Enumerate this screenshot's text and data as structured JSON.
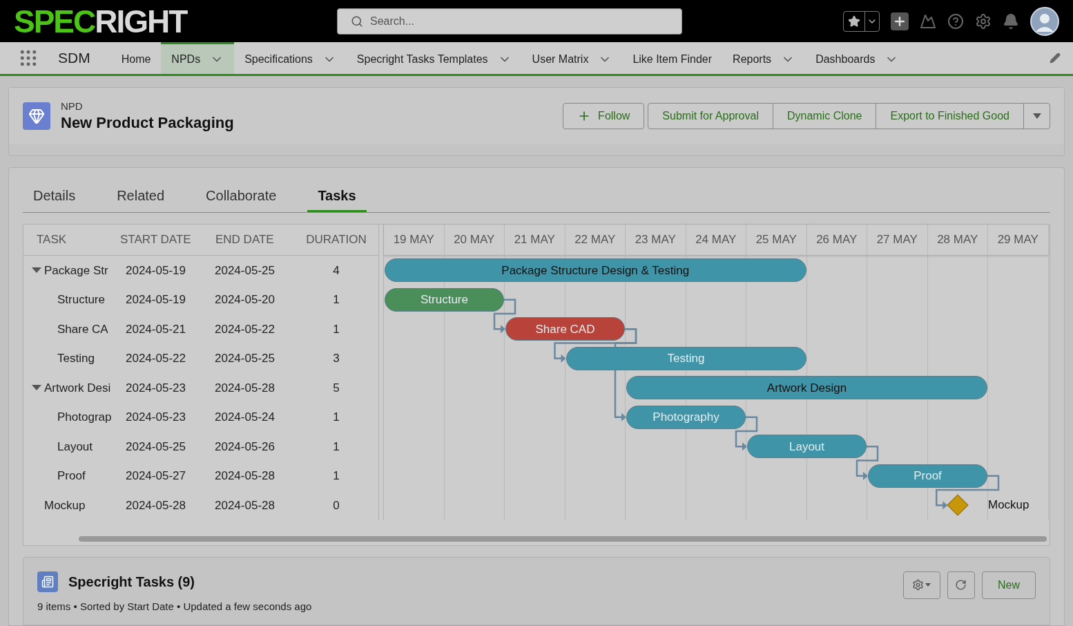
{
  "header": {
    "logo": {
      "part_1": "SPEC",
      "part_2": "RIGHT"
    },
    "search": {
      "placeholder": "Search..."
    }
  },
  "nav": {
    "app_name": "SDM",
    "items": [
      {
        "label": "Home",
        "has_menu": false,
        "selected": false
      },
      {
        "label": "NPDs",
        "has_menu": true,
        "selected": true
      },
      {
        "label": "Specifications",
        "has_menu": true,
        "selected": false
      },
      {
        "label": "Specright Tasks Templates",
        "has_menu": true,
        "selected": false
      },
      {
        "label": "User Matrix",
        "has_menu": true,
        "selected": false
      },
      {
        "label": "Like Item Finder",
        "has_menu": false,
        "selected": false
      },
      {
        "label": "Reports",
        "has_menu": true,
        "selected": false
      },
      {
        "label": "Dashboards",
        "has_menu": true,
        "selected": false
      }
    ]
  },
  "record": {
    "type": "NPD",
    "title": "New Product Packaging",
    "follow_label": "Follow",
    "actions": [
      "Submit for Approval",
      "Dynamic Clone",
      "Export to Finished Good"
    ]
  },
  "tabs": [
    {
      "label": "Details",
      "selected": false
    },
    {
      "label": "Related",
      "selected": false
    },
    {
      "label": "Collaborate",
      "selected": false
    },
    {
      "label": "Tasks",
      "selected": true
    }
  ],
  "gantt": {
    "columns": [
      "TASK",
      "START DATE",
      "END DATE",
      "DURATION"
    ],
    "days": [
      "19 MAY",
      "20 MAY",
      "21 MAY",
      "22 MAY",
      "23 MAY",
      "24 MAY",
      "25 MAY",
      "26 MAY",
      "27 MAY",
      "28 MAY",
      "29 MAY"
    ],
    "tasks": [
      {
        "kind": "summary",
        "name": "Package Str",
        "bar_label": "Package Structure Design & Testing",
        "start": "2024-05-19",
        "end": "2024-05-25",
        "duration": "4",
        "color": "#4094a8",
        "expanded": true,
        "children": [
          {
            "kind": "task",
            "name": "Structure",
            "bar_label": "Structure",
            "start": "2024-05-19",
            "end": "2024-05-20",
            "duration": "1",
            "color": "#4a8f5a"
          },
          {
            "kind": "task",
            "name": "Share CA",
            "bar_label": "Share CAD",
            "start": "2024-05-21",
            "end": "2024-05-22",
            "duration": "1",
            "color": "#b8433a"
          },
          {
            "kind": "task",
            "name": "Testing",
            "bar_label": "Testing",
            "start": "2024-05-22",
            "end": "2024-05-25",
            "duration": "3",
            "color": "#4094a8"
          }
        ]
      },
      {
        "kind": "summary",
        "name": "Artwork Desi",
        "bar_label": "Artwork Design",
        "start": "2024-05-23",
        "end": "2024-05-28",
        "duration": "5",
        "color": "#4094a8",
        "expanded": true,
        "children": [
          {
            "kind": "task",
            "name": "Photograp",
            "bar_label": "Photography",
            "start": "2024-05-23",
            "end": "2024-05-24",
            "duration": "1",
            "color": "#4094a8"
          },
          {
            "kind": "task",
            "name": "Layout",
            "bar_label": "Layout",
            "start": "2024-05-25",
            "end": "2024-05-26",
            "duration": "1",
            "color": "#4094a8"
          },
          {
            "kind": "task",
            "name": "Proof",
            "bar_label": "Proof",
            "start": "2024-05-27",
            "end": "2024-05-28",
            "duration": "1",
            "color": "#4094a8"
          }
        ]
      },
      {
        "kind": "milestone",
        "name": "Mockup",
        "bar_label": "Mockup",
        "start": "2024-05-28",
        "end": "2024-05-28",
        "duration": "0",
        "color": "#c8960a"
      }
    ]
  },
  "related_list": {
    "title": "Specright Tasks (9)",
    "summary": "9 items • Sorted by Start Date • Updated a few seconds ago",
    "new_label": "New"
  }
}
